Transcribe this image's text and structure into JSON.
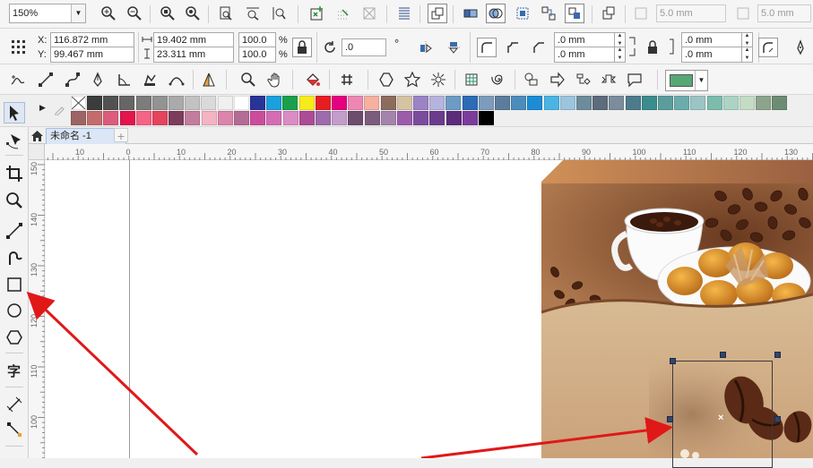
{
  "zoom": {
    "value": "150%",
    "arrow": "▼"
  },
  "toolbar1": {
    "width_value": "5.0 mm",
    "height_value": "5.0 mm"
  },
  "properties": {
    "x_label": "X:",
    "x_value": "116.872 mm",
    "y_label": "Y:",
    "y_value": "99.467 mm",
    "w_value": "19.402 mm",
    "h_value": "23.311 mm",
    "scale_w": "100.0",
    "scale_h": "100.0",
    "percent": "%",
    "rotation": ".0",
    "degree": "°",
    "corner_1": ".0 mm",
    "corner_2": ".0 mm",
    "corner_3": ".0 mm",
    "corner_4": ".0 mm"
  },
  "fill_color": "#55a874",
  "palette": {
    "row1": [
      "#3c3c3c",
      "#515151",
      "#666666",
      "#7c7c7c",
      "#939393",
      "#aaaaaa",
      "#c2c2c2",
      "#dadada",
      "#f0f0f0",
      "#ffffff",
      "#28349a",
      "#1aa0dc",
      "#1aa04c",
      "#f6ec1c",
      "#e61e24",
      "#e4007e",
      "#ee86b4",
      "#f6b0a0",
      "#8c6c5c",
      "#d4c4a4",
      "#9c84c4",
      "#b4b4dc",
      "#6c9cc4",
      "#2c6cb4",
      "#7c9cbc",
      "#5c7c9c",
      "#4c8cbc",
      "#1c8cd4",
      "#4cb4e4",
      "#9cc4dc",
      "#6c8c9c",
      "#5c6c7c",
      "#7c8c9c",
      "#4c7c8c",
      "#3c8c8c",
      "#5c9c9c",
      "#6cacac",
      "#9cc4c4",
      "#7cbcac",
      "#acd4c4",
      "#c4dcc4",
      "#8ca48c",
      "#6c8c74"
    ],
    "row2": [
      "#9c6464",
      "#c46c6c",
      "#dc5c7c",
      "#e4144c",
      "#f46484",
      "#e4445c",
      "#7c3c5c",
      "#c47c9c",
      "#f4b4c4",
      "#dc84ac",
      "#b46c94",
      "#cc4c9c",
      "#d46cb4",
      "#dc8cc4",
      "#ac4c94",
      "#9c6cac",
      "#c49ccc",
      "#6c4c6c",
      "#7c5c7c",
      "#a484ac",
      "#9c5cac",
      "#7c4c9c",
      "#6c3c8c",
      "#5c2c7c",
      "#7c3c9c",
      "#000000"
    ]
  },
  "tab": {
    "title": "未命名 -1",
    "add": "+"
  },
  "ruler": {
    "top": [
      "10",
      "0",
      "10",
      "20",
      "30",
      "40",
      "50",
      "60",
      "70",
      "80",
      "90",
      "100",
      "110",
      "120",
      "130"
    ],
    "left": [
      "150",
      "140",
      "130",
      "120",
      "110",
      "100"
    ]
  }
}
